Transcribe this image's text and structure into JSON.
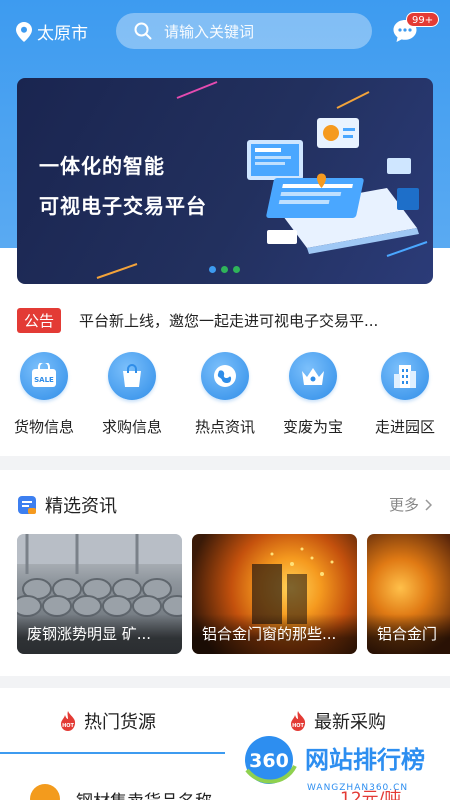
{
  "header": {
    "city": "太原市",
    "search_placeholder": "请输入关键词",
    "message_badge": "99+"
  },
  "banner": {
    "line1": "一体化的智能",
    "line2": "可视电子交易平台",
    "dots": 3
  },
  "notice": {
    "tag": "公告",
    "text": "平台新上线，邀您一起走进可视电子交易平..."
  },
  "categories": [
    {
      "label": "货物信息",
      "icon": "sale-bag-icon"
    },
    {
      "label": "求购信息",
      "icon": "shopping-bag-icon"
    },
    {
      "label": "热点资讯",
      "icon": "globe-icon"
    },
    {
      "label": "变废为宝",
      "icon": "crown-icon"
    },
    {
      "label": "走进园区",
      "icon": "building-icon"
    }
  ],
  "news": {
    "title": "精选资讯",
    "more": "更多",
    "cards": [
      {
        "caption": "废钢涨势明显 矿..."
      },
      {
        "caption": "铝合金门窗的那些..."
      },
      {
        "caption": "铝合金门"
      }
    ]
  },
  "tabs": {
    "hot": "热门货源",
    "latest": "最新采购"
  },
  "listing": {
    "name": "钢材集卖货品名称",
    "price": "12元/吨"
  },
  "watermark": {
    "brand": "360",
    "text": "网站排行榜",
    "url": "WANGZHAN360.CN"
  },
  "colors": {
    "primary": "#3d9bf0",
    "alert": "#e33b35",
    "banner_bg": "#1f2b5a"
  }
}
